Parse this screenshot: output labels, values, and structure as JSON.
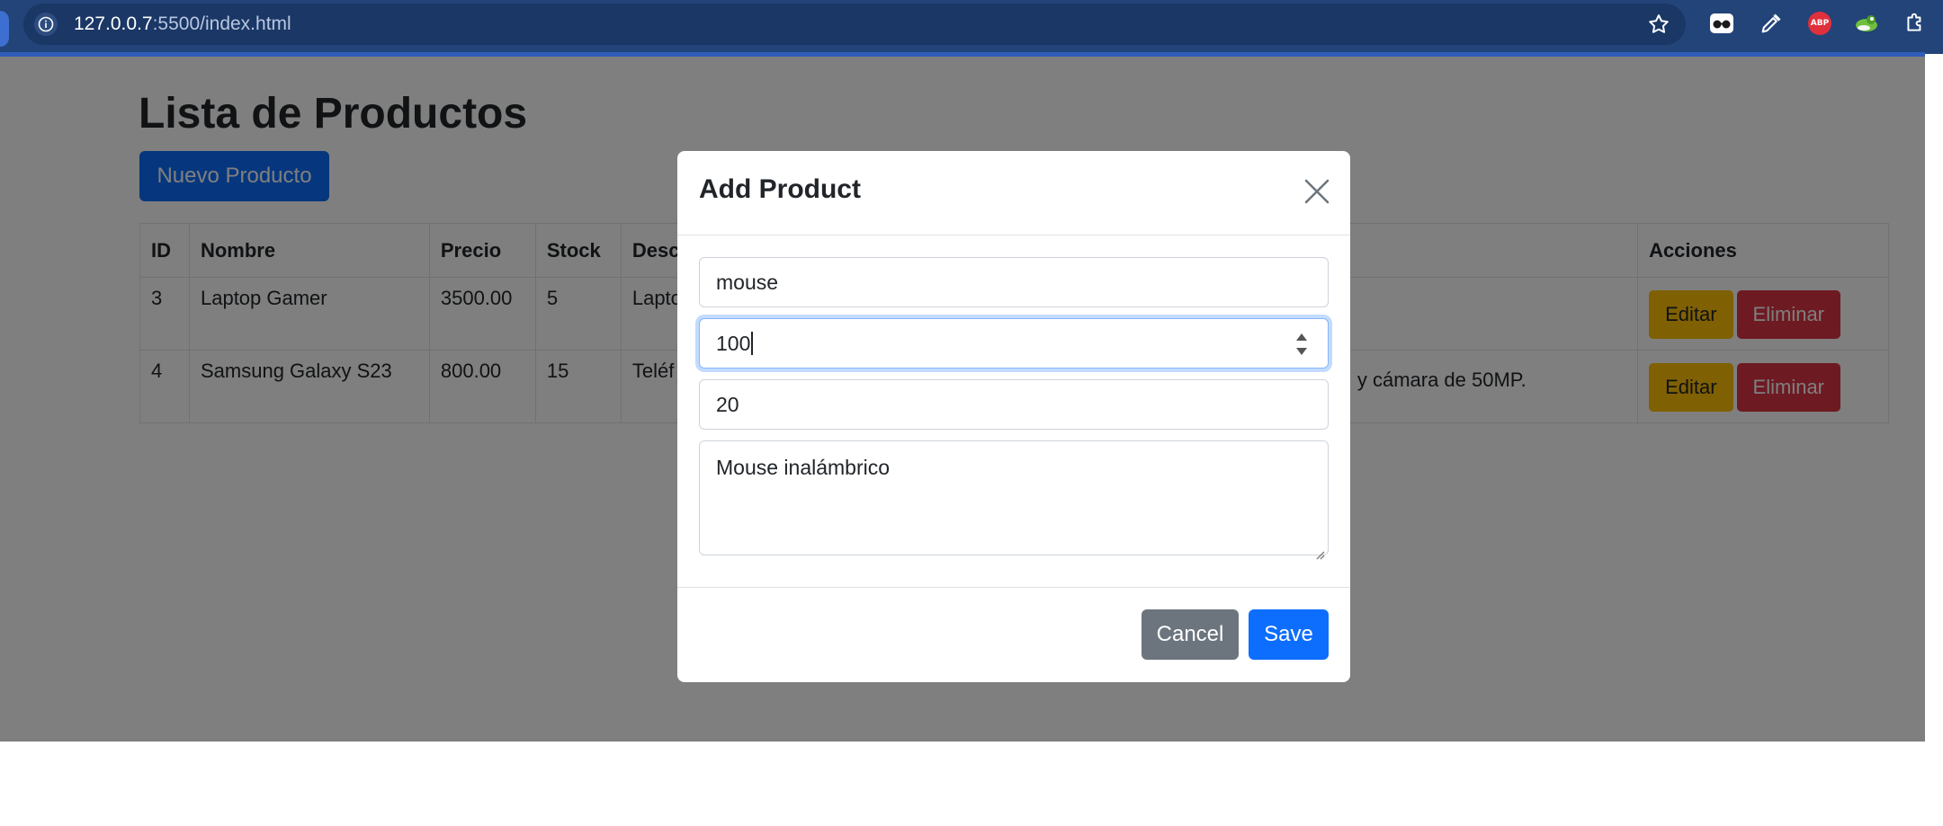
{
  "browser": {
    "url_host": "127.0.0.7",
    "url_rest": ":5500/index.html",
    "extensions": [
      "incognito-glasses-icon",
      "eyedropper-icon",
      "adblock-plus-icon",
      "chameleon-icon",
      "extensions-puzzle-icon"
    ],
    "abp_label": "ABP"
  },
  "page": {
    "title": "Lista de Productos",
    "new_button": "Nuevo Producto",
    "table": {
      "headers": [
        "ID",
        "Nombre",
        "Precio",
        "Stock",
        "Desc",
        "Acciones"
      ],
      "rows": [
        {
          "id": "3",
          "nombre": "Laptop Gamer",
          "precio": "3500.00",
          "stock": "5",
          "desc_left": "Lapto",
          "desc_right": ""
        },
        {
          "id": "4",
          "nombre": "Samsung Galaxy S23",
          "precio": "800.00",
          "stock": "15",
          "desc_left": "Teléf",
          "desc_right": "y cámara de 50MP."
        }
      ],
      "edit_label": "Editar",
      "delete_label": "Eliminar"
    }
  },
  "modal": {
    "title": "Add Product",
    "name_value": "mouse",
    "price_value": "100",
    "stock_value": "20",
    "description_value": "Mouse inalámbrico",
    "cancel_label": "Cancel",
    "save_label": "Save"
  },
  "colors": {
    "primary": "#0d6efd",
    "warning": "#ffc107",
    "danger": "#dc3545",
    "secondary": "#6c757d",
    "browser_bar": "#234478"
  }
}
